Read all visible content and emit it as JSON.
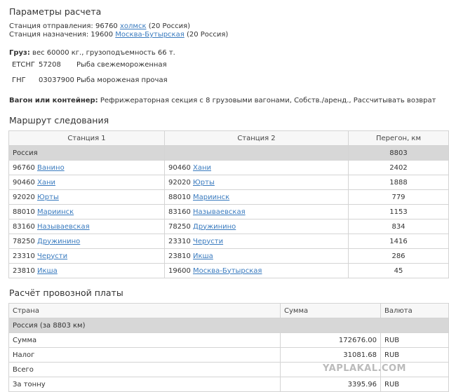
{
  "params": {
    "title": "Параметры расчета",
    "dep_label": "Станция отправления:",
    "dep_code": "96760",
    "dep_name": "холмск",
    "dep_country": "(20 Россия)",
    "dest_label": "Станция назначения:",
    "dest_code": "19600",
    "dest_name": "Москва-Бутырская",
    "dest_country": "(20 Россия)",
    "cargo_label": "Груз:",
    "cargo_text": "вес 60000 кг., грузоподъемность 66 т.",
    "cargo_codes": [
      {
        "system": "ЕТСНГ",
        "code": "57208",
        "name": "Рыба свежемороженная"
      },
      {
        "system": "ГНГ",
        "code": "03037900",
        "name": "Рыба мороженая прочая"
      }
    ],
    "wagon_label": "Вагон или контейнер:",
    "wagon_text": "Рефрижераторная секция с 8 грузовыми вагонами, Собств./аренд., Рассчитывать возврат"
  },
  "route": {
    "title": "Маршрут следования",
    "headers": [
      "Станция 1",
      "Станция 2",
      "Перегон, км"
    ],
    "group": {
      "name": "Россия",
      "total": "8803"
    },
    "rows": [
      {
        "s1_code": "96760",
        "s1_name": "Ванино",
        "s2_code": "90460",
        "s2_name": "Хани",
        "km": "2402"
      },
      {
        "s1_code": "90460",
        "s1_name": "Хани",
        "s2_code": "92020",
        "s2_name": "Юрты",
        "km": "1888"
      },
      {
        "s1_code": "92020",
        "s1_name": "Юрты",
        "s2_code": "88010",
        "s2_name": "Мариинск",
        "km": "779"
      },
      {
        "s1_code": "88010",
        "s1_name": "Мариинск",
        "s2_code": "83160",
        "s2_name": "Называевская",
        "km": "1153"
      },
      {
        "s1_code": "83160",
        "s1_name": "Называевская",
        "s2_code": "78250",
        "s2_name": "Дружинино",
        "km": "834"
      },
      {
        "s1_code": "78250",
        "s1_name": "Дружинино",
        "s2_code": "23310",
        "s2_name": "Черусти",
        "km": "1416"
      },
      {
        "s1_code": "23310",
        "s1_name": "Черусти",
        "s2_code": "23810",
        "s2_name": "Икша",
        "km": "286"
      },
      {
        "s1_code": "23810",
        "s1_name": "Икша",
        "s2_code": "19600",
        "s2_name": "Москва-Бутырская",
        "km": "45"
      }
    ]
  },
  "fare": {
    "title": "Расчёт провозной платы",
    "headers": [
      "Страна",
      "Сумма",
      "Валюта"
    ],
    "group": "Россия (за 8803 км)",
    "rows": [
      {
        "label": "Сумма",
        "amount": "172676.00",
        "currency": "RUB"
      },
      {
        "label": "Налог",
        "amount": "31081.68",
        "currency": "RUB"
      },
      {
        "label": "Всего",
        "amount": "",
        "currency": ""
      },
      {
        "label": "За тонну",
        "amount": "3395.96",
        "currency": "RUB"
      }
    ]
  },
  "watermark": "YAPLAKAL.COM"
}
